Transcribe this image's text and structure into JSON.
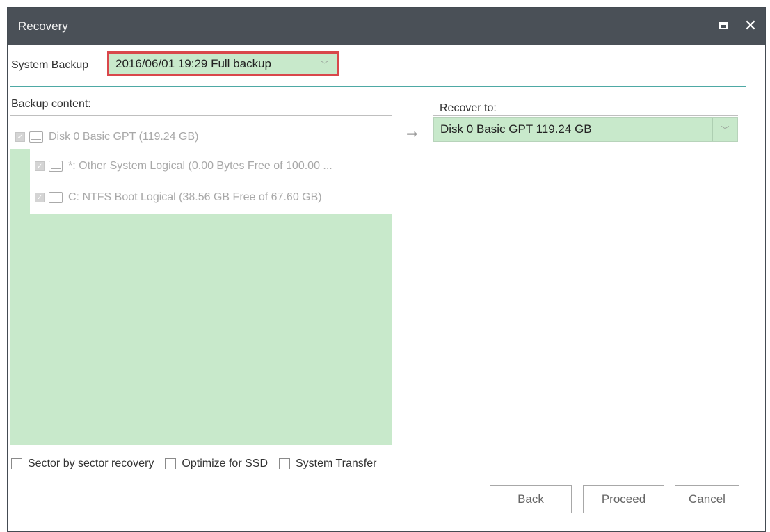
{
  "window": {
    "title": "Recovery"
  },
  "system_backup": {
    "label": "System Backup",
    "selected": "2016/06/01 19:29 Full backup"
  },
  "backup_content": {
    "label": "Backup content:",
    "disk": {
      "label": "Disk 0 Basic GPT (119.24 GB)"
    },
    "partitions": [
      {
        "label": "*: Other System Logical  (0.00 Bytes Free of 100.00 ..."
      },
      {
        "label": "C: NTFS Boot Logical  (38.56 GB Free of 67.60 GB)"
      }
    ]
  },
  "recover_to": {
    "label": "Recover to:",
    "selected": "Disk 0 Basic GPT 119.24 GB"
  },
  "options": [
    {
      "label": "Sector by sector recovery"
    },
    {
      "label": "Optimize for SSD"
    },
    {
      "label": "System Transfer"
    }
  ],
  "buttons": {
    "back": "Back",
    "proceed": "Proceed",
    "cancel": "Cancel"
  },
  "colors": {
    "titlebar": "#4a5057",
    "accent_line": "#4ea9a5",
    "selection_green": "#c8e9cb",
    "highlight_red": "#d9474b"
  },
  "icons": {
    "maximize": "maximize-icon",
    "close": "close-icon",
    "disk": "disk-icon",
    "arrow": "arrow-right-icon"
  }
}
